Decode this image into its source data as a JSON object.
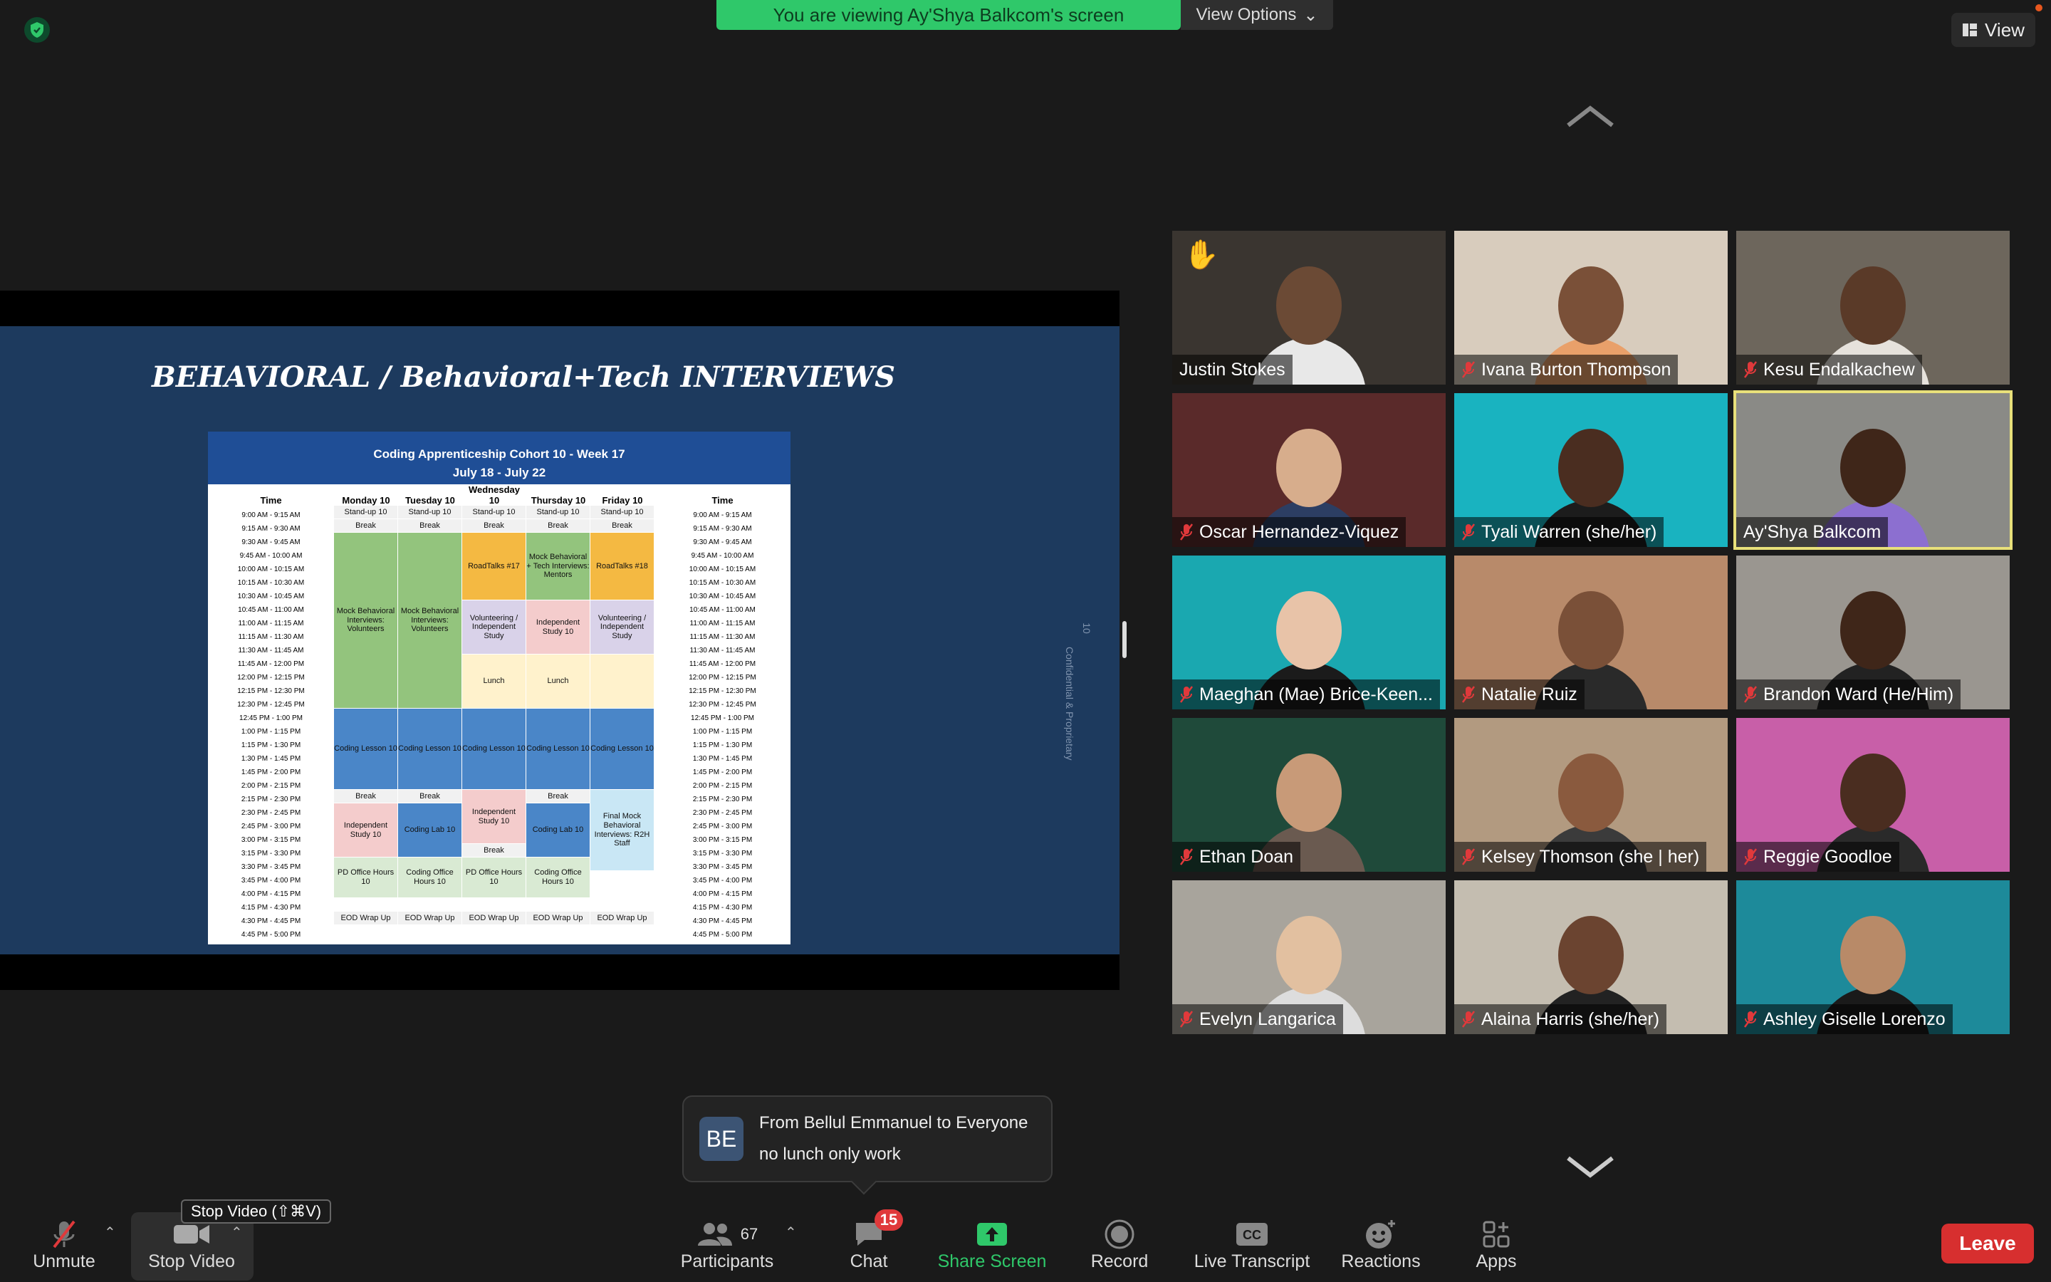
{
  "banner": {
    "text": "You are viewing Ay'Shya Balkcom's screen",
    "view_options": "View Options"
  },
  "view_button": "View",
  "slide": {
    "title": "BEHAVIORAL / Behavioral+Tech INTERVIEWS",
    "side_label": "Confidential & Proprietary",
    "side_number": "10",
    "schedule": {
      "title": "Coding Apprenticeship Cohort 10 - Week 17",
      "dates": "July 18 - July 22",
      "headers": [
        "Time",
        "Monday 10",
        "Tuesday 10",
        "Wednesday 10",
        "Thursday 10",
        "Friday 10",
        "Time"
      ],
      "times": [
        "9:00 AM - 9:15 AM",
        "9:15 AM - 9:30 AM",
        "9:30 AM - 9:45 AM",
        "9:45 AM - 10:00 AM",
        "10:00 AM - 10:15 AM",
        "10:15 AM - 10:30 AM",
        "10:30 AM - 10:45 AM",
        "10:45 AM - 11:00 AM",
        "11:00 AM - 11:15 AM",
        "11:15 AM - 11:30 AM",
        "11:30 AM - 11:45 AM",
        "11:45 AM - 12:00 PM",
        "12:00 PM - 12:15 PM",
        "12:15 PM - 12:30 PM",
        "12:30 PM - 12:45 PM",
        "12:45 PM - 1:00 PM",
        "1:00 PM - 1:15 PM",
        "1:15 PM - 1:30 PM",
        "1:30 PM - 1:45 PM",
        "1:45 PM - 2:00 PM",
        "2:00 PM - 2:15 PM",
        "2:15 PM - 2:30 PM",
        "2:30 PM - 2:45 PM",
        "2:45 PM - 3:00 PM",
        "3:00 PM - 3:15 PM",
        "3:15 PM - 3:30 PM",
        "3:30 PM - 3:45 PM",
        "3:45 PM - 4:00 PM",
        "4:00 PM - 4:15 PM",
        "4:15 PM - 4:30 PM",
        "4:30 PM - 4:45 PM",
        "4:45 PM - 5:00 PM"
      ],
      "blocks": {
        "standup": "Stand-up 10",
        "break": "Break",
        "mock_volunteers": "Mock Behavioral Interviews: Volunteers",
        "roadtalks17": "RoadTalks #17",
        "mock_mentors": "Mock Behavioral + Tech Interviews: Mentors",
        "roadtalks18": "RoadTalks #18",
        "volunteering": "Volunteering / Independent Study",
        "independent": "Independent Study 10",
        "lunch": "Lunch",
        "coding_lesson": "Coding Lesson 10",
        "coding_lab": "Coding Lab 10",
        "final_mock": "Final Mock Behavioral Interviews: R2H Staff",
        "pd_office": "PD Office Hours 10",
        "coding_office": "Coding Office Hours 10",
        "eod": "EOD Wrap Up"
      }
    }
  },
  "participants_tiles": [
    {
      "name": "Justin Stokes",
      "muted": false,
      "hand": true,
      "bg": "#3a3530",
      "skin": "#6b4a35",
      "shirt": "#e8e8e8"
    },
    {
      "name": "Ivana Burton Thompson",
      "muted": true,
      "hand": false,
      "bg": "#d8ccbd",
      "skin": "#7a5038",
      "shirt": "#e9a06a"
    },
    {
      "name": "Kesu Endalkachew",
      "muted": true,
      "hand": false,
      "bg": "#6d665c",
      "skin": "#5a3a28",
      "shirt": "#e6e2dc"
    },
    {
      "name": "Oscar Hernandez-Viquez",
      "muted": true,
      "hand": false,
      "bg": "#5a2a2a",
      "skin": "#d7ad8c",
      "shirt": "#2c3e63"
    },
    {
      "name": "Tyali Warren (she/her)",
      "muted": true,
      "hand": false,
      "bg": "#19b3c0",
      "skin": "#4a2d20",
      "shirt": "#1c1c1c"
    },
    {
      "name": "Ay'Shya Balkcom",
      "muted": false,
      "hand": false,
      "bg": "#8a8a86",
      "skin": "#3f2619",
      "shirt": "#8c6fd0"
    },
    {
      "name": "Maeghan (Mae) Brice-Keen...",
      "muted": true,
      "hand": false,
      "bg": "#1aa8b0",
      "skin": "#e8c3a8",
      "shirt": "#1b1b1b"
    },
    {
      "name": "Natalie Ruiz",
      "muted": true,
      "hand": false,
      "bg": "#b88a6a",
      "skin": "#7a5038",
      "shirt": "#2a2a2a"
    },
    {
      "name": "Brandon Ward (He/Him)",
      "muted": true,
      "hand": false,
      "bg": "#9a9690",
      "skin": "#3f2619",
      "shirt": "#222"
    },
    {
      "name": "Ethan Doan",
      "muted": true,
      "hand": false,
      "bg": "#1f4a3a",
      "skin": "#c89a78",
      "shirt": "#6a5a50"
    },
    {
      "name": "Kelsey Thomson  (she | her)",
      "muted": true,
      "hand": false,
      "bg": "#b29a80",
      "skin": "#8a5a3e",
      "shirt": "#3b3b3b"
    },
    {
      "name": "Reggie Goodloe",
      "muted": true,
      "hand": false,
      "bg": "#c85fa8",
      "skin": "#4a2d20",
      "shirt": "#2a2a2a"
    },
    {
      "name": "Evelyn Langarica",
      "muted": true,
      "hand": false,
      "bg": "#a8a49c",
      "skin": "#e2c0a0",
      "shirt": "#ddd"
    },
    {
      "name": "Alaina Harris  (she/her)",
      "muted": true,
      "hand": false,
      "bg": "#c4bdb0",
      "skin": "#6b4430",
      "shirt": "#222"
    },
    {
      "name": "Ashley Giselle Lorenzo",
      "muted": true,
      "hand": false,
      "bg": "#1d8a9a",
      "skin": "#b88a68",
      "shirt": "#1a1a1a"
    }
  ],
  "chat_popup": {
    "initials": "BE",
    "from": "From Bellul Emmanuel to Everyone",
    "message": "no lunch only work"
  },
  "tooltip": "Stop Video (⇧⌘V)",
  "toolbar": {
    "unmute": "Unmute",
    "stop_video": "Stop Video",
    "participants": "Participants",
    "participants_count": "67",
    "chat": "Chat",
    "chat_badge": "15",
    "share_screen": "Share Screen",
    "record": "Record",
    "live_transcript": "Live Transcript",
    "reactions": "Reactions",
    "apps": "Apps",
    "leave": "Leave"
  }
}
